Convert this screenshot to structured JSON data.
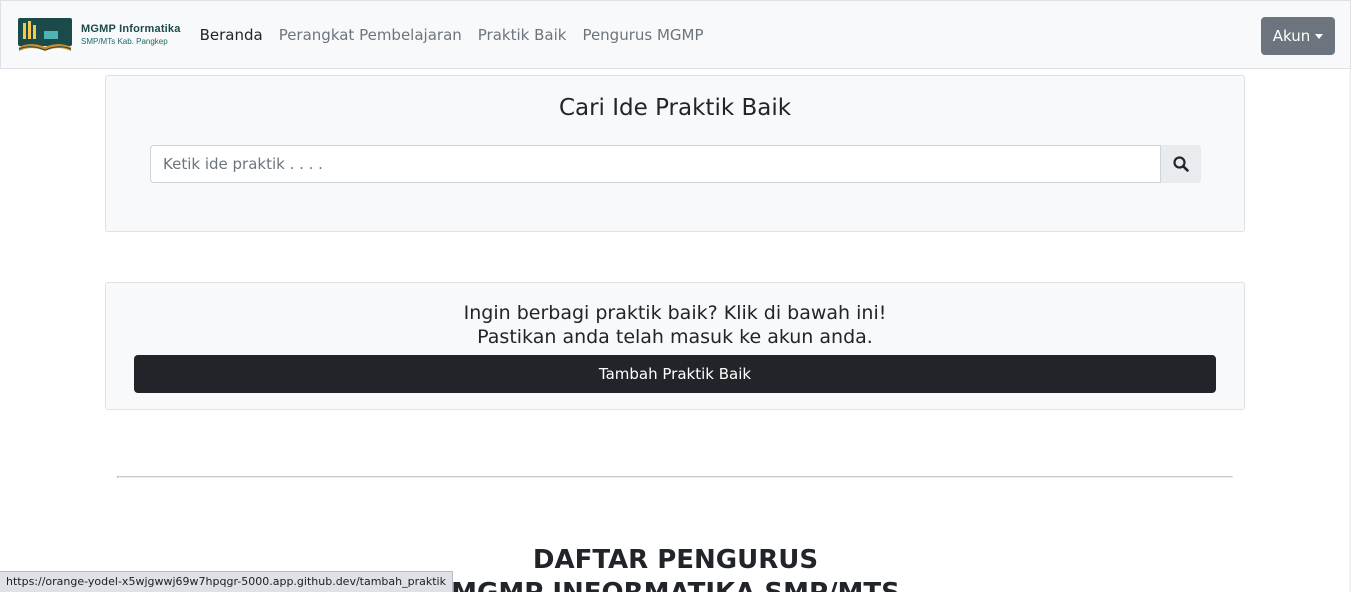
{
  "navbar": {
    "brand_title": "MGMP Informatika",
    "brand_subtitle": "SMP/MTs Kab. Pangkep",
    "links": [
      {
        "label": "Beranda",
        "active": true
      },
      {
        "label": "Perangkat Pembelajaran",
        "active": false
      },
      {
        "label": "Praktik Baik",
        "active": false
      },
      {
        "label": "Pengurus MGMP",
        "active": false
      }
    ],
    "account_label": "Akun"
  },
  "search": {
    "title": "Cari Ide Praktik Baik",
    "placeholder": "Ketik ide praktik . . . .",
    "button_icon": "search-icon"
  },
  "share": {
    "line1": "Ingin berbagi praktik baik? Klik di bawah ini!",
    "line2": "Pastikan anda telah masuk ke akun anda.",
    "button_label": "Tambah Praktik Baik"
  },
  "pengurus": {
    "line1": "DAFTAR PENGURUS",
    "line2": "MGMP INFORMATIKA SMP/MTS"
  },
  "status_bar": {
    "url": "https://orange-yodel-x5wjgwwj69w7hpqgr-5000.app.github.dev/tambah_praktik"
  },
  "colors": {
    "navbar_bg": "#f8f9fa",
    "account_button": "#6c757d",
    "primary_dark": "#212529",
    "brand_teal": "#1b4a4a"
  }
}
